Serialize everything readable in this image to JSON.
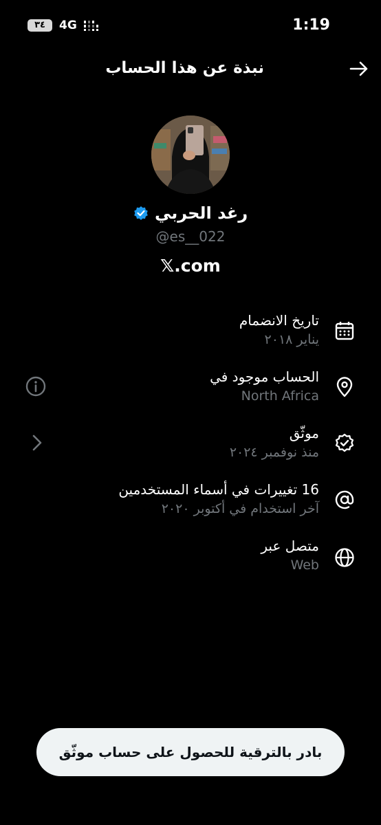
{
  "status_bar": {
    "battery": "٣٤",
    "network": "4G",
    "time": "1:19"
  },
  "header": {
    "title": "نبذة عن هذا الحساب",
    "back_icon": "arrow-right-icon"
  },
  "profile": {
    "display_name": "رغد الحربي",
    "handle": "@es__022",
    "verified": true,
    "link": "𝕏.com",
    "colors": {
      "verified_badge": "#1d9bf0"
    }
  },
  "info": {
    "joined": {
      "title": "تاريخ الانضمام",
      "value": "يناير ٢٠١٨",
      "icon": "calendar-icon"
    },
    "location": {
      "title": "الحساب موجود في",
      "value": "North Africa",
      "icon": "location-pin-icon",
      "side_icon": "info-icon"
    },
    "verified": {
      "title": "موثّق",
      "value": "منذ نوفمبر ٢٠٢٤",
      "icon": "verified-check-icon",
      "side_icon": "chevron-right-icon"
    },
    "username_changes": {
      "title": "16 تغييرات في أسماء المستخدمين",
      "value": "آخر استخدام في أكتوبر ٢٠٢٠",
      "icon": "at-sign-icon"
    },
    "connected_via": {
      "title": "متصل عبر",
      "value": "Web",
      "icon": "globe-icon"
    }
  },
  "upgrade_button": {
    "label": "بادر بالترقية للحصول على حساب موثّق"
  }
}
